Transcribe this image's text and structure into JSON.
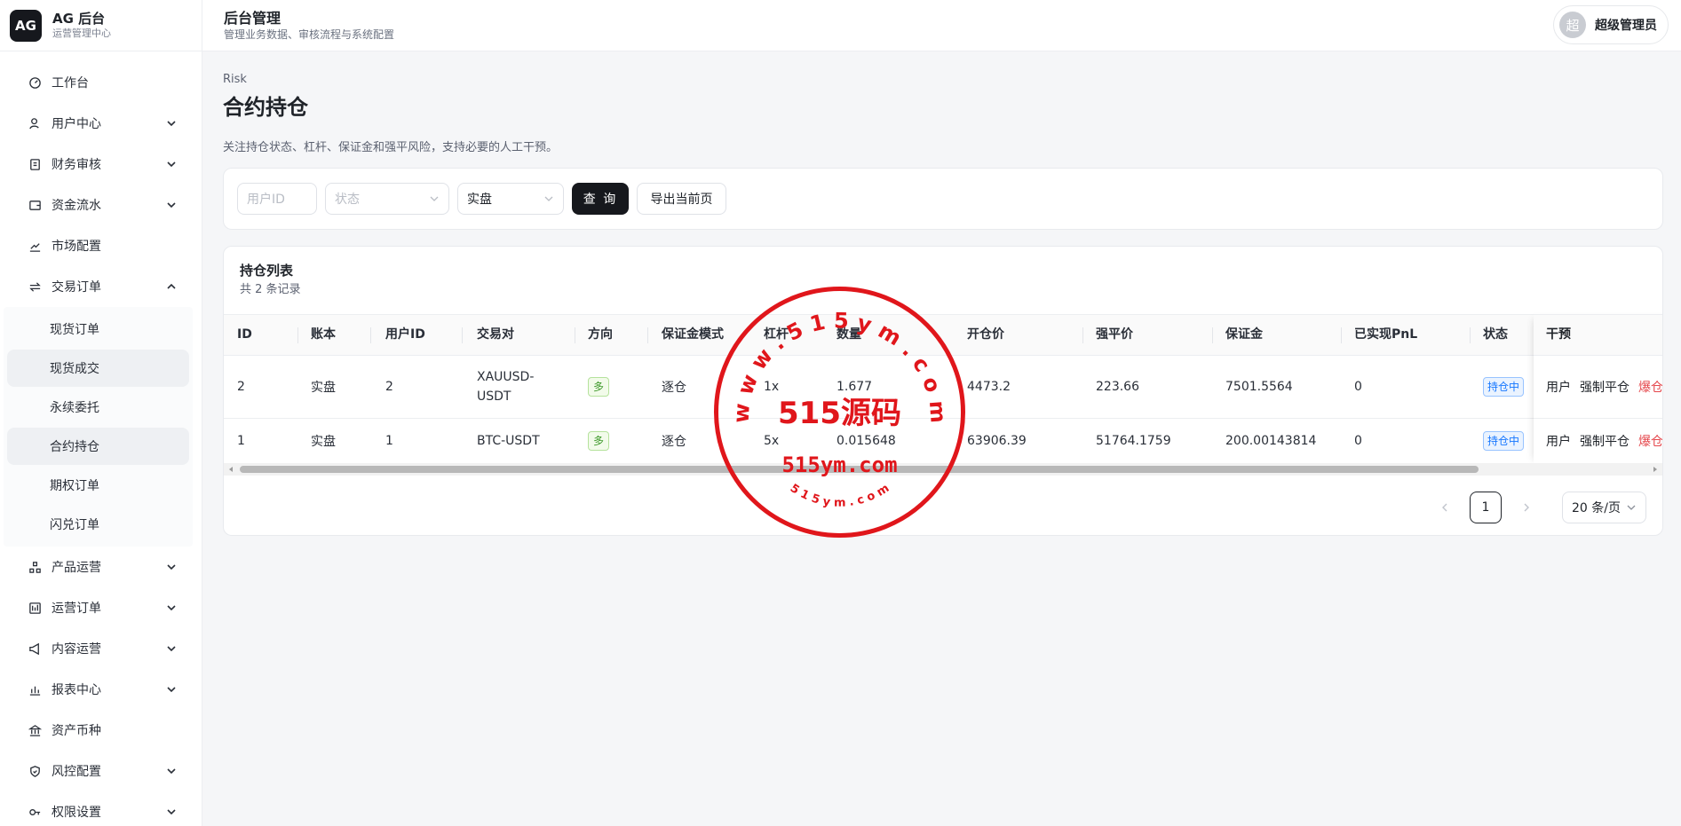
{
  "brand": {
    "logo": "AG",
    "title": "AG 后台",
    "subtitle": "运营管理中心"
  },
  "header": {
    "title": "后台管理",
    "subtitle": "管理业务数据、审核流程与系统配置"
  },
  "user": {
    "avatar_text": "超",
    "name": "超级管理员"
  },
  "sidebar": {
    "items": [
      {
        "label": "工作台",
        "icon": "dashboard-icon"
      },
      {
        "label": "用户中心",
        "icon": "user-icon"
      },
      {
        "label": "财务审核",
        "icon": "audit-icon"
      },
      {
        "label": "资金流水",
        "icon": "wallet-icon"
      },
      {
        "label": "市场配置",
        "icon": "chart-line-icon"
      },
      {
        "label": "交易订单",
        "icon": "swap-icon"
      }
    ],
    "trade_sub": [
      "现货订单",
      "现货成交",
      "永续委托",
      "合约持仓",
      "期权订单",
      "闪兑订单"
    ],
    "items_after": [
      {
        "label": "产品运营",
        "icon": "cluster-icon"
      },
      {
        "label": "运营订单",
        "icon": "orders-icon"
      },
      {
        "label": "内容运营",
        "icon": "megaphone-icon"
      },
      {
        "label": "报表中心",
        "icon": "bar-chart-icon"
      },
      {
        "label": "资产币种",
        "icon": "bank-icon"
      },
      {
        "label": "风控配置",
        "icon": "shield-icon"
      },
      {
        "label": "权限设置",
        "icon": "key-icon"
      }
    ]
  },
  "page": {
    "breadcrumb": "Risk",
    "title": "合约持仓",
    "description": "关注持仓状态、杠杆、保证金和强平风险，支持必要的人工干预。"
  },
  "filters": {
    "user_id_placeholder": "用户ID",
    "status_placeholder": "状态",
    "account_value": "实盘",
    "query_label": "查 询",
    "export_label": "导出当前页"
  },
  "list": {
    "title": "持仓列表",
    "count": "共 2 条记录",
    "columns": [
      "ID",
      "账本",
      "用户ID",
      "交易对",
      "方向",
      "保证金模式",
      "杠杆",
      "数量",
      "开仓价",
      "强平价",
      "保证金",
      "已实现PnL",
      "状态",
      "干预"
    ],
    "rows": [
      {
        "id": "2",
        "ledger": "实盘",
        "uid": "2",
        "pair_line1": "XAUUSD-",
        "pair_line2": "USDT",
        "side": "多",
        "margin_mode": "逐仓",
        "leverage": "1x",
        "qty": "1.677",
        "open_price": "4473.2",
        "liq_price": "223.66",
        "margin": "7501.5564",
        "pnl": "0",
        "status": "持仓中",
        "act_user": "用户",
        "act_force": "强制平仓",
        "act_liq": "爆仓"
      },
      {
        "id": "1",
        "ledger": "实盘",
        "uid": "1",
        "pair_line1": "BTC-USDT",
        "pair_line2": "",
        "side": "多",
        "margin_mode": "逐仓",
        "leverage": "5x",
        "qty": "0.015648",
        "open_price": "63906.39",
        "liq_price": "51764.1759",
        "margin": "200.00143814",
        "pnl": "0",
        "status": "持仓中",
        "act_user": "用户",
        "act_force": "强制平仓",
        "act_liq": "爆仓"
      }
    ]
  },
  "pagination": {
    "current": "1",
    "page_size": "20 条/页"
  },
  "watermark": {
    "top_arc": "w w w . 5 1 5 y m . c o m",
    "center": "515源码",
    "domain": "515ym.com",
    "bottom_arc": "5 1 5 y m . c o m"
  },
  "colors": {
    "primary": "#16181d",
    "danger": "#e5484d",
    "tag_green": "#3f9a2c",
    "tag_blue": "#1677ff",
    "watermark": "#e0161b"
  }
}
